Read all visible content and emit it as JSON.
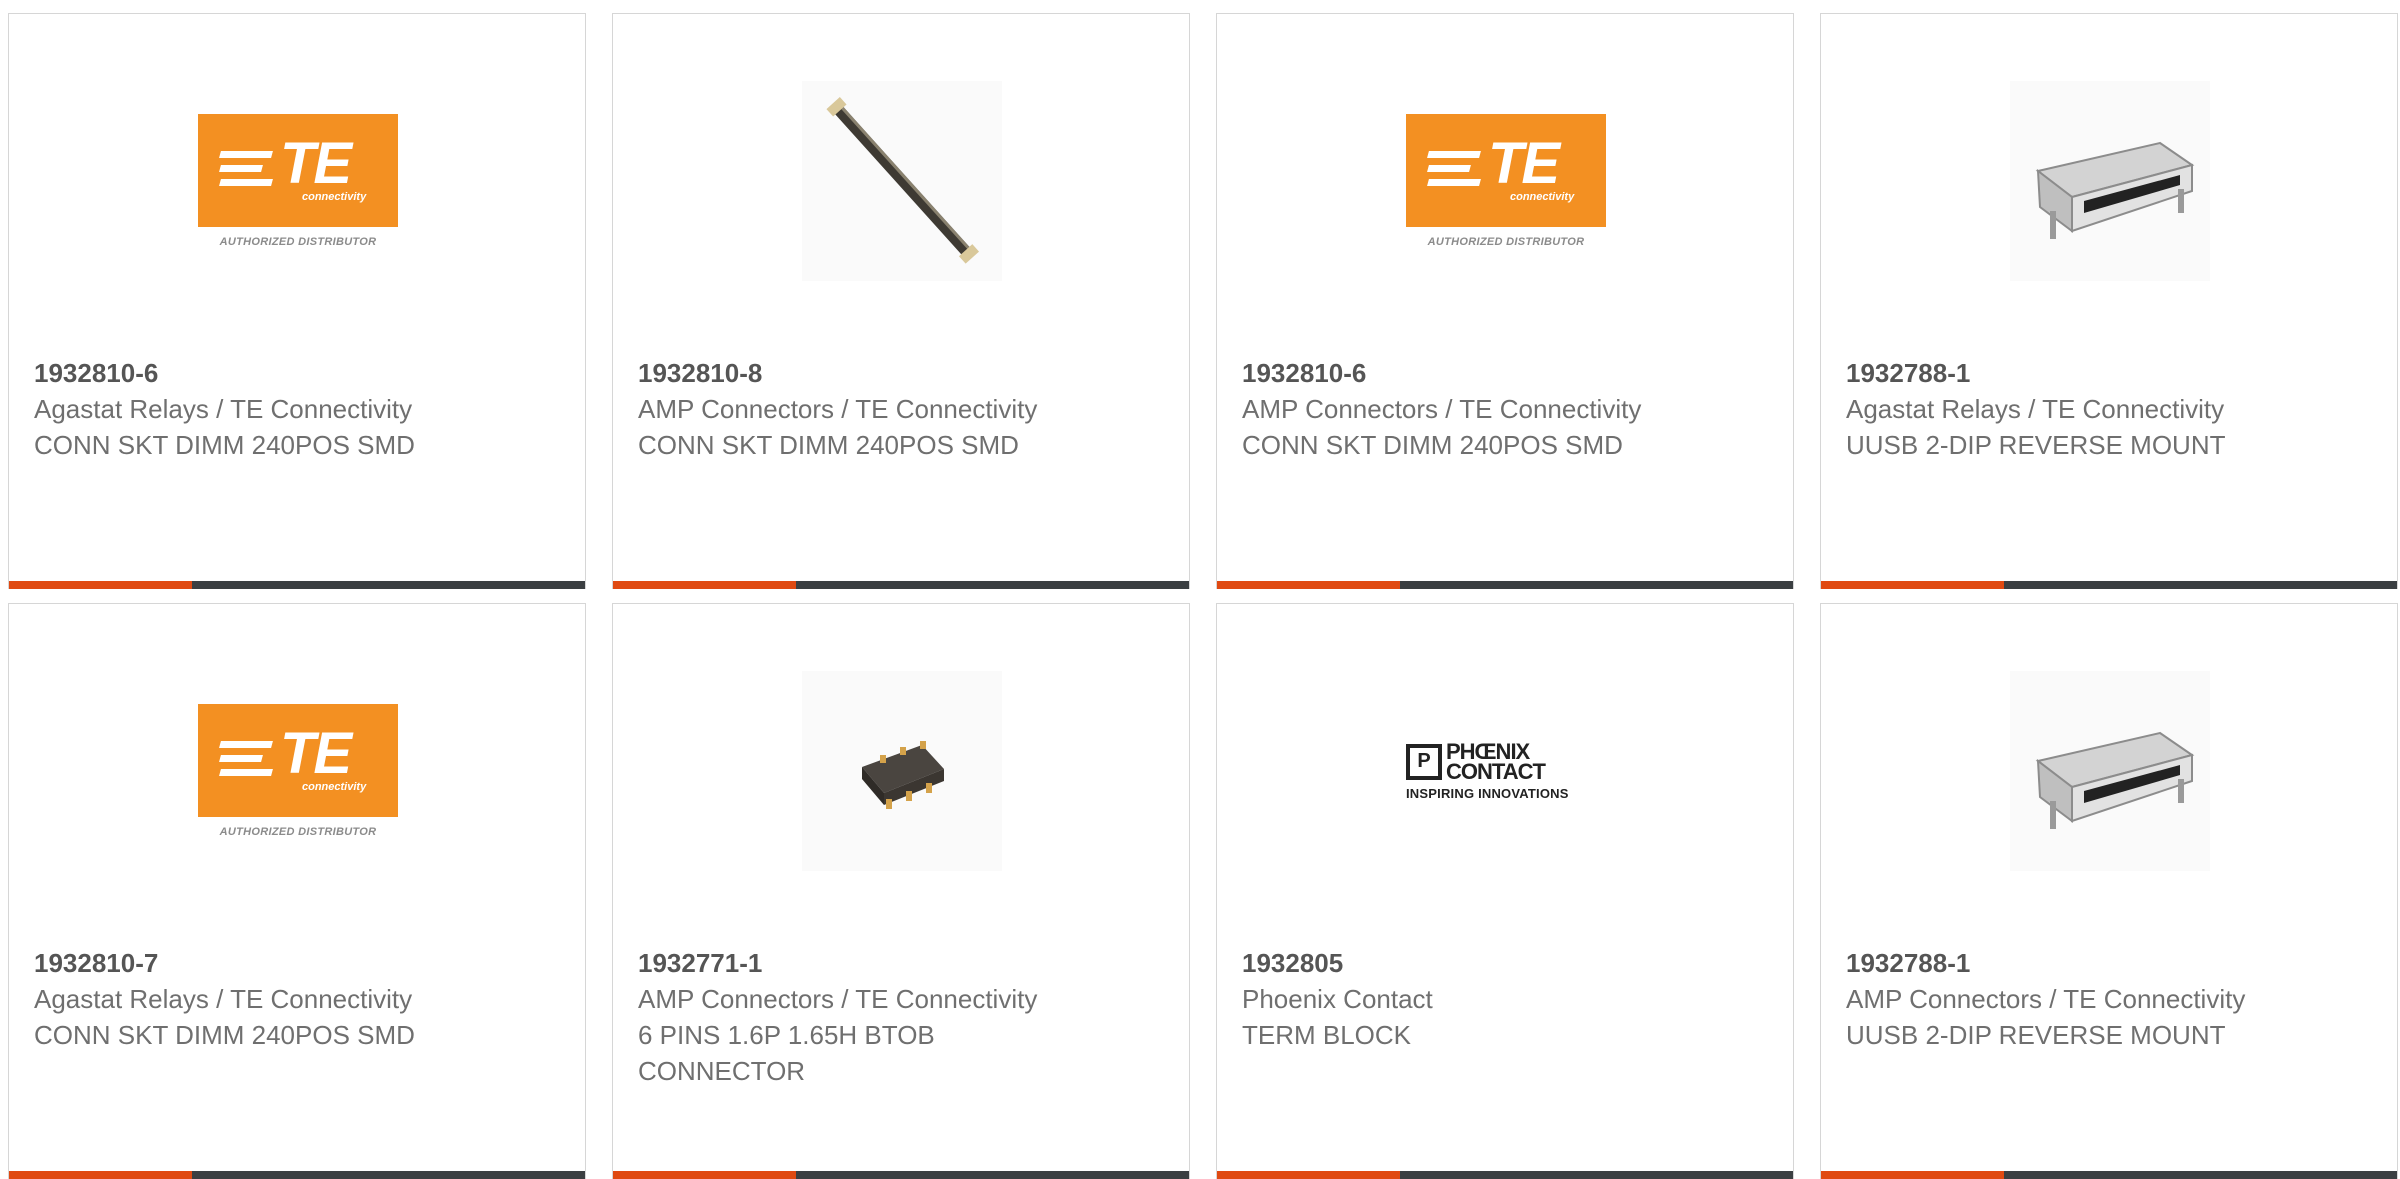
{
  "products": [
    {
      "part_number": "1932810-6",
      "manufacturer": "Agastat Relays / TE Connectivity",
      "description": "CONN SKT DIMM 240POS SMD",
      "image": "te-authorized-distributor-logo"
    },
    {
      "part_number": "1932810-8",
      "manufacturer": "AMP Connectors / TE Connectivity",
      "description": "CONN SKT DIMM 240POS SMD",
      "image": "dimm-socket-photo"
    },
    {
      "part_number": "1932810-6",
      "manufacturer": "AMP Connectors / TE Connectivity",
      "description": "CONN SKT DIMM 240POS SMD",
      "image": "te-authorized-distributor-logo"
    },
    {
      "part_number": "1932788-1",
      "manufacturer": "Agastat Relays / TE Connectivity",
      "description": "UUSB 2-DIP REVERSE MOUNT",
      "image": "micro-usb-connector-photo"
    },
    {
      "part_number": "1932810-7",
      "manufacturer": "Agastat Relays / TE Connectivity",
      "description": "CONN SKT DIMM 240POS SMD",
      "image": "te-authorized-distributor-logo"
    },
    {
      "part_number": "1932771-1",
      "manufacturer": "AMP Connectors / TE Connectivity",
      "description": "6 PINS 1.6P 1.65H BTOB CONNECTOR",
      "image": "btob-connector-photo"
    },
    {
      "part_number": "1932805",
      "manufacturer": "Phoenix Contact",
      "description": "TERM BLOCK",
      "image": "phoenix-contact-logo"
    },
    {
      "part_number": "1932788-1",
      "manufacturer": "AMP Connectors / TE Connectivity",
      "description": "UUSB 2-DIP REVERSE MOUNT",
      "image": "micro-usb-connector-photo"
    }
  ],
  "logos": {
    "te": {
      "letters": "TE",
      "sub": "connectivity",
      "tagline": "AUTHORIZED DISTRIBUTOR"
    },
    "phoenix": {
      "mark": "P",
      "name_line1": "PHŒNIX",
      "name_line2": "CONTACT",
      "tagline": "INSPIRING INNOVATIONS"
    }
  },
  "colors": {
    "accent": "#e04a12",
    "bar": "#3b3f42",
    "te_orange": "#f39022",
    "text": "#6f6f6f"
  }
}
